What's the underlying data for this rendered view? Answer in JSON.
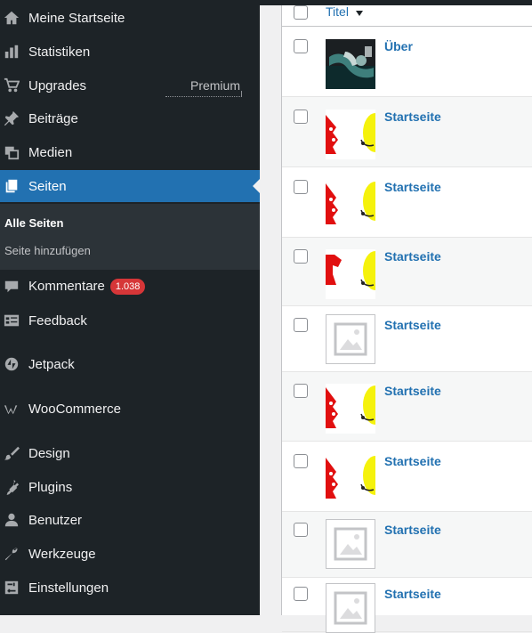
{
  "sidebar": {
    "items": [
      {
        "label": "Meine Startseite",
        "icon": "home-icon"
      },
      {
        "label": "Statistiken",
        "icon": "stats-icon"
      },
      {
        "label": "Upgrades",
        "icon": "cart-icon",
        "extra": "Premium"
      },
      {
        "label": "Beiträge",
        "icon": "pushpin-icon"
      },
      {
        "label": "Medien",
        "icon": "media-icon"
      },
      {
        "label": "Seiten",
        "icon": "pages-icon",
        "active": true
      },
      {
        "label": "Kommentare",
        "icon": "comment-icon",
        "badge": "1.038"
      },
      {
        "label": "Feedback",
        "icon": "feedback-icon"
      },
      {
        "label": "Jetpack",
        "icon": "jetpack-icon"
      },
      {
        "label": "WooCommerce",
        "icon": "woocommerce-icon"
      },
      {
        "label": "Design",
        "icon": "paintbrush-icon"
      },
      {
        "label": "Plugins",
        "icon": "plugin-icon"
      },
      {
        "label": "Benutzer",
        "icon": "user-icon"
      },
      {
        "label": "Werkzeuge",
        "icon": "wrench-icon"
      },
      {
        "label": "Einstellungen",
        "icon": "settings-icon"
      }
    ],
    "submenu": [
      {
        "label": "Alle Seiten",
        "current": true
      },
      {
        "label": "Seite hinzufügen"
      }
    ]
  },
  "table": {
    "column_title": "Titel",
    "rows": [
      {
        "title": "Über",
        "thumb": "photo"
      },
      {
        "title": "Startseite",
        "thumb": "mascot"
      },
      {
        "title": "Startseite",
        "thumb": "mascot"
      },
      {
        "title": "Startseite",
        "thumb": "mascot"
      },
      {
        "title": "Startseite",
        "thumb": "placeholder"
      },
      {
        "title": "Startseite",
        "thumb": "mascot"
      },
      {
        "title": "Startseite",
        "thumb": "mascot"
      },
      {
        "title": "Startseite",
        "thumb": "placeholder"
      },
      {
        "title": "Startseite",
        "thumb": "placeholder"
      }
    ]
  },
  "colors": {
    "sidebar_bg": "#1d2327",
    "accent": "#2271b1",
    "badge": "#d63638"
  }
}
